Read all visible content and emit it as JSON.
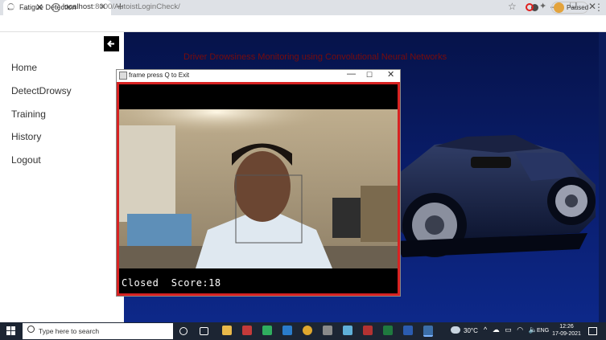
{
  "browser": {
    "tab_title": "Fatigue Detection",
    "tab_close": "✕",
    "new_tab": "+",
    "address_host": "localhost",
    "address_path": ":8000/AutoistLoginCheck/",
    "profile_label": "Paused",
    "nav": {
      "back": "←",
      "forward": "→",
      "stop": "✕",
      "info": "i"
    },
    "star": "☆",
    "menu": "⋮",
    "window": {
      "min": "—",
      "restore": "❐",
      "close": "✕"
    }
  },
  "sidebar": {
    "collapse_icon": "🡐",
    "items": [
      {
        "label": "Home"
      },
      {
        "label": "DetectDrowsy"
      },
      {
        "label": "Training"
      },
      {
        "label": "History"
      },
      {
        "label": "Logout"
      }
    ]
  },
  "main": {
    "heading": "Driver Drowsiness Monitoring using Convolutional Neural Networks"
  },
  "cv_window": {
    "title": "frame press Q to Exit",
    "min": "—",
    "max": "☐",
    "close": "✕",
    "status_text": "Closed  Score:18"
  },
  "taskbar": {
    "search_placeholder": "Type here to search",
    "temperature": "30°C",
    "tray_icons": "^ ☁ ▭ ◠ 🔈",
    "language": "ENG",
    "time": "12:26",
    "date": "17-09-2021"
  },
  "colors": {
    "accent_red": "#d72222",
    "heading_red": "#7a0b0b",
    "main_bg": "#0a1e6e"
  }
}
